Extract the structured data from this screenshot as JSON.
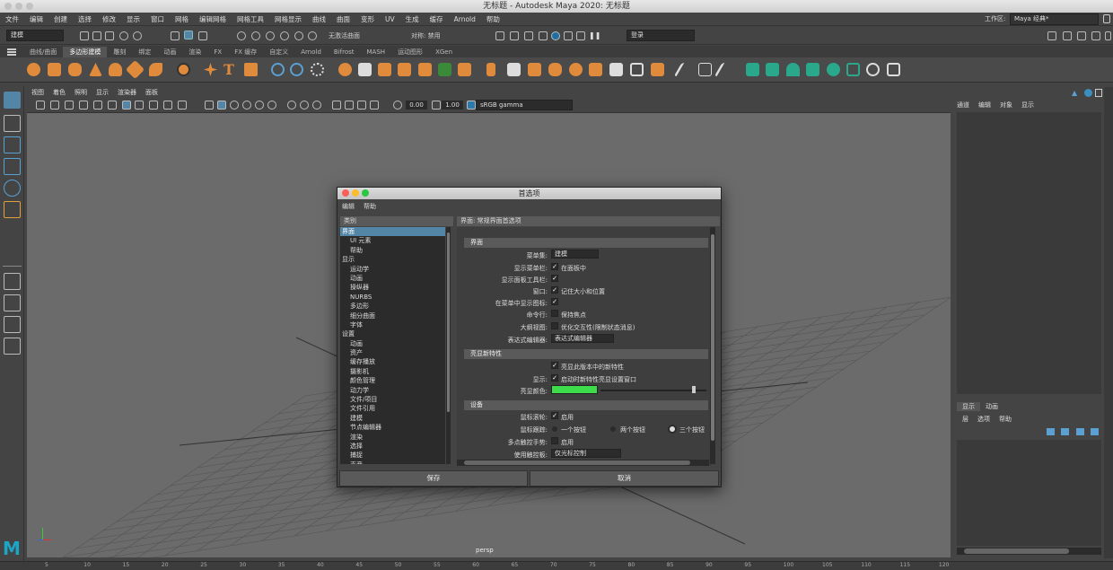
{
  "window": {
    "title": "无标题 - Autodesk Maya 2020: 无标题"
  },
  "menubar": [
    "文件",
    "编辑",
    "创建",
    "选择",
    "修改",
    "显示",
    "窗口",
    "网格",
    "编辑网格",
    "网格工具",
    "网格显示",
    "曲线",
    "曲面",
    "变形",
    "UV",
    "生成",
    "缓存",
    "Arnold",
    "帮助"
  ],
  "workspace": {
    "label": "工作区:",
    "value": "Maya 经典*"
  },
  "statusline": {
    "mode": "建模",
    "live_surface": "无激活曲面",
    "symmetry": "对称: 禁用",
    "login": "登录"
  },
  "shelf_tabs": [
    "曲线/曲面",
    "多边形建模",
    "雕刻",
    "绑定",
    "动画",
    "渲染",
    "FX",
    "FX 缓存",
    "自定义",
    "Arnold",
    "Bifrost",
    "MASH",
    "运动图形",
    "XGen"
  ],
  "shelf_active": "多边形建模",
  "viewport": {
    "menu": [
      "视图",
      "着色",
      "照明",
      "显示",
      "渲染器",
      "面板"
    ],
    "exposure": "0.00",
    "gamma": "1.00",
    "colorspace": "sRGB gamma",
    "camera": "persp"
  },
  "rightpanel": {
    "menu": [
      "通道",
      "编辑",
      "对象",
      "显示"
    ],
    "layer_tabs": [
      "显示",
      "动画"
    ],
    "layer_menu": [
      "层",
      "选项",
      "帮助"
    ]
  },
  "timeline": {
    "ticks": [
      "5",
      "10",
      "15",
      "20",
      "25",
      "30",
      "35",
      "40",
      "45",
      "50",
      "55",
      "60",
      "65",
      "70",
      "75",
      "80",
      "85",
      "90",
      "95",
      "100",
      "105",
      "110",
      "115",
      "120"
    ]
  },
  "dialog": {
    "title": "首选项",
    "menu": [
      "编辑",
      "帮助"
    ],
    "category_header": "类别",
    "content_header": "界面: 常规界面首选项",
    "categories": [
      {
        "label": "界面",
        "sub": false,
        "selected": true
      },
      {
        "label": "UI 元素",
        "sub": true
      },
      {
        "label": "帮助",
        "sub": true
      },
      {
        "label": "显示",
        "sub": false
      },
      {
        "label": "运动学",
        "sub": true
      },
      {
        "label": "动画",
        "sub": true
      },
      {
        "label": "操纵器",
        "sub": true
      },
      {
        "label": "NURBS",
        "sub": true
      },
      {
        "label": "多边形",
        "sub": true
      },
      {
        "label": "细分曲面",
        "sub": true
      },
      {
        "label": "字体",
        "sub": true
      },
      {
        "label": "设置",
        "sub": false
      },
      {
        "label": "动画",
        "sub": true
      },
      {
        "label": "资产",
        "sub": true
      },
      {
        "label": "缓存播放",
        "sub": true
      },
      {
        "label": "摄影机",
        "sub": true
      },
      {
        "label": "颜色管理",
        "sub": true
      },
      {
        "label": "动力学",
        "sub": true
      },
      {
        "label": "文件/项目",
        "sub": true
      },
      {
        "label": "文件引用",
        "sub": true
      },
      {
        "label": "建模",
        "sub": true
      },
      {
        "label": "节点编辑器",
        "sub": true
      },
      {
        "label": "渲染",
        "sub": true
      },
      {
        "label": "选择",
        "sub": true
      },
      {
        "label": "捕捉",
        "sub": true
      },
      {
        "label": "声音",
        "sub": true
      }
    ],
    "sections": {
      "interface": {
        "title": "界面",
        "menu_set_label": "菜单集:",
        "menu_set_value": "建模",
        "show_menubar_label": "显示菜单栏:",
        "show_menubar_text": "在面板中",
        "show_panel_toolbar_label": "显示面板工具栏:",
        "windows_label": "窗口:",
        "windows_text": "记住大小和位置",
        "show_icons_label": "在菜单中显示图标:",
        "command_line_label": "命令行:",
        "command_line_text": "保持焦点",
        "outliner_label": "大纲视图:",
        "outliner_text": "优化交互性(限制状态消息)",
        "expr_editor_label": "表达式编辑器:",
        "expr_editor_value": "表达式编辑器"
      },
      "highlight": {
        "title": "亮显新特性",
        "text1": "亮显此版本中的新特性",
        "show_label": "显示:",
        "show_text": "启动时新特性亮显设置窗口",
        "color_label": "亮显颜色:",
        "color": "#3ddc4a",
        "slider_value": 0.88
      },
      "devices": {
        "title": "设备",
        "wheel_label": "鼠标滚轮:",
        "wheel_text": "启用",
        "tracking_label": "鼠标跟踪:",
        "opt1": "一个按钮",
        "opt2": "两个按钮",
        "opt3": "三个按钮",
        "multitouch_label": "多点触控手势:",
        "multitouch_text": "启用",
        "trackpad_label": "使用触控板:",
        "trackpad_value": "仅光标控制"
      }
    },
    "save_label": "保存",
    "cancel_label": "取消"
  }
}
